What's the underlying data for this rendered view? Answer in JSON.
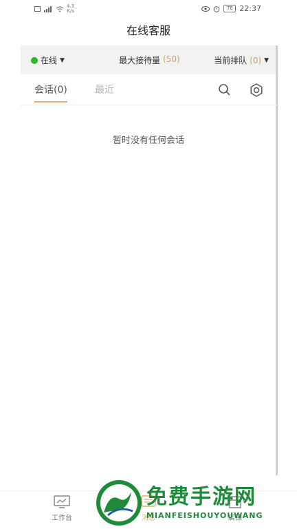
{
  "status_bar": {
    "net_speed_value": "4.3",
    "net_speed_unit": "K/s",
    "time": "22:37",
    "battery": "78"
  },
  "header": {
    "title": "在线客服"
  },
  "status_row": {
    "online_label": "在线",
    "max_label": "最大接待量",
    "max_value": "(50)",
    "queue_label": "当前排队",
    "queue_value": "(0)"
  },
  "tabs": {
    "sessions": "会话(0)",
    "recent": "最近"
  },
  "empty_text": "暂时没有任何会话",
  "bottom_nav": [
    {
      "label": "工作台",
      "icon": "monitor-icon"
    },
    {
      "label": "消息",
      "icon": "message-icon"
    },
    {
      "label": "店铺",
      "icon": "store-icon"
    }
  ],
  "watermark": {
    "title": "免费手游网",
    "subtitle": "MIANFEISHOUYOUWANG"
  },
  "colors": {
    "online": "#2ab52a",
    "accent": "#d8b27a",
    "watermark": "#1e8a3a"
  }
}
